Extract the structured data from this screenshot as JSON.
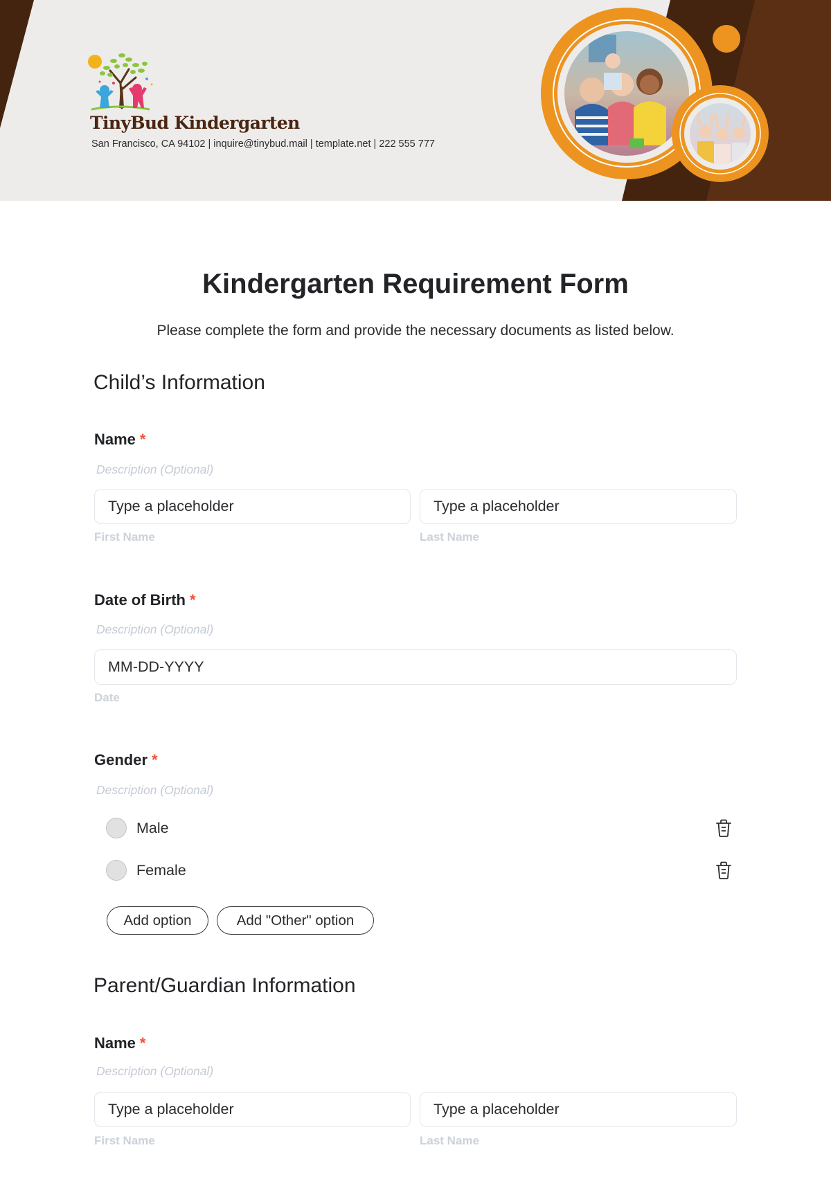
{
  "header": {
    "brand_name": "TinyBud Kindergarten",
    "contact_line": "San Francisco, CA 94102 | inquire@tinybud.mail | template.net | 222 555 777",
    "logo_icon": "tree-with-children-logo",
    "photos": [
      "children-cheering-photo",
      "children-raising-hands-photo"
    ],
    "colors": {
      "dark_brown": "#45240f",
      "brown": "#5b2f14",
      "orange": "#ec941f",
      "light_bg": "#eeeceb"
    }
  },
  "form": {
    "title": "Kindergarten Requirement Form",
    "subtitle": "Please complete the form and provide the necessary documents as listed below.",
    "required_mark": "*",
    "sections": [
      {
        "title": "Child’s Information",
        "fields": [
          {
            "label": "Name",
            "description": "Description (Optional)",
            "inputs": [
              {
                "placeholder": "Type a placeholder",
                "sublabel": "First Name"
              },
              {
                "placeholder": "Type a placeholder",
                "sublabel": "Last Name"
              }
            ]
          },
          {
            "label": "Date of Birth",
            "description": "Description (Optional)",
            "inputs": [
              {
                "placeholder": "MM-DD-YYYY",
                "sublabel": "Date"
              }
            ]
          },
          {
            "label": "Gender",
            "description": "Description (Optional)",
            "options": [
              "Male",
              "Female"
            ],
            "add_option_label": "Add option",
            "add_other_option_label": "Add \"Other\" option"
          }
        ]
      },
      {
        "title": "Parent/Guardian Information",
        "fields": [
          {
            "label": "Name",
            "description": "Description (Optional)",
            "inputs": [
              {
                "placeholder": "Type a placeholder",
                "sublabel": "First Name"
              },
              {
                "placeholder": "Type a placeholder",
                "sublabel": "Last Name"
              }
            ]
          }
        ]
      }
    ]
  }
}
